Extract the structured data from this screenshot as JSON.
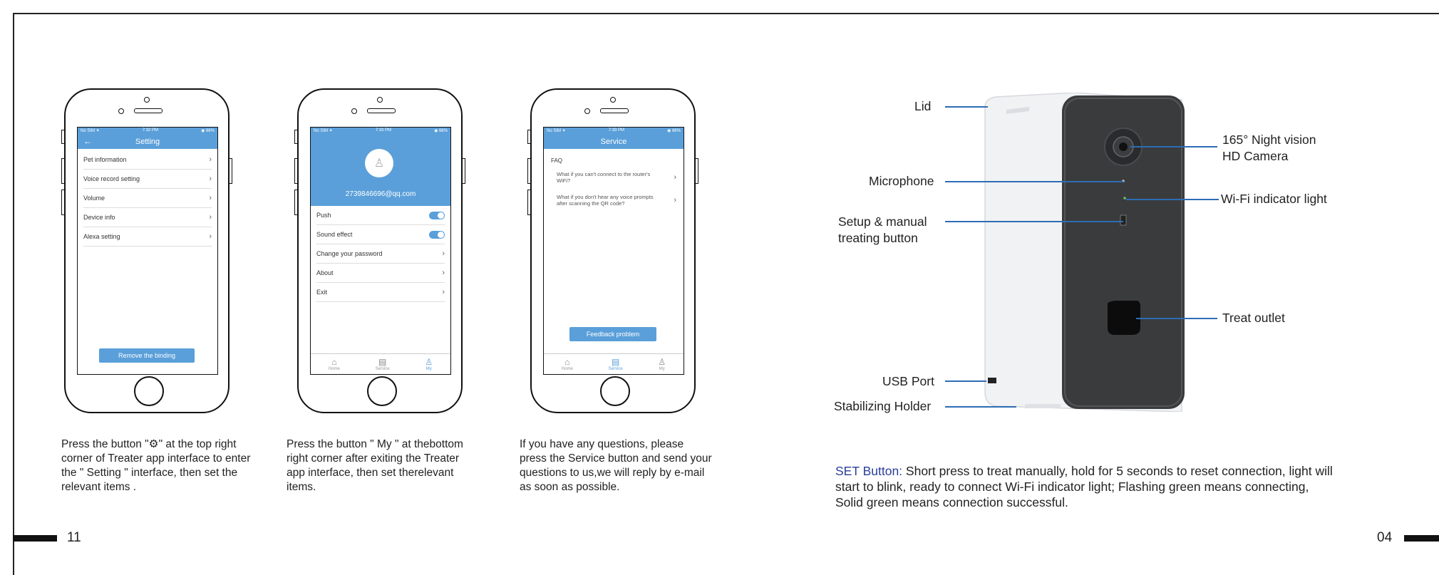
{
  "phones": [
    {
      "status_left": "No SIM ✦",
      "status_time": "7:32 PM",
      "status_right": "◉ 66%",
      "title": "Setting",
      "rows": [
        "Pet information",
        "Voice record setting",
        "Volume",
        "Device info",
        "Alexa setting"
      ],
      "button": "Remove the binding"
    },
    {
      "status_left": "No SIM ✦",
      "status_time": "7:33 PM",
      "status_right": "◉ 66%",
      "email": "2739846696@qq.com",
      "toggle_rows": [
        "Push",
        "Sound effect"
      ],
      "rows": [
        "Change your password",
        "About",
        "Exit"
      ],
      "tabs": [
        "Home",
        "Service",
        "My"
      ],
      "active_tab": "My"
    },
    {
      "status_left": "No SIM ✦",
      "status_time": "7:33 PM",
      "status_right": "◉ 66%",
      "title": "Service",
      "faq_heading": "FAQ",
      "faqs": [
        "What if you can't connect to the router's WiFi?",
        "What if you don't hear any voice prompts after scanning the QR code?"
      ],
      "button": "Feedback problem",
      "tabs": [
        "Home",
        "Service",
        "My"
      ],
      "active_tab": "Service"
    }
  ],
  "captions": [
    "Press the button \"⚙\" at the top right corner of Treater app interface to enter the \" Setting \" interface, then set the relevant items .",
    "Press the button \" My \" at thebottom right corner after exiting the Treater app interface,  then set therelevant items.",
    "If you have any questions, please press the Service button and send your questions to us,we will reply by e-mail as soon as possible."
  ],
  "device_labels": {
    "lid": "Lid",
    "microphone": "Microphone",
    "setup_button_line1": "Setup & manual",
    "setup_button_line2": "treating button",
    "usb": "USB Port",
    "holder": "Stabilizing Holder",
    "camera_line1": "165° Night vision",
    "camera_line2": "HD Camera",
    "wifi": "Wi-Fi indicator light",
    "outlet": "Treat outlet"
  },
  "set_info": {
    "heading": "SET Button:",
    "text": " Short press to treat manually, hold for 5 seconds to reset connection, light will start to blink, ready to connect Wi-Fi indicator light; Flashing green means connecting, Solid green means connection successful."
  },
  "page_left": "11",
  "page_right": "04",
  "colors": {
    "app_blue": "#5a9fd9",
    "leader_blue": "#2d6db5",
    "device_face": "#3a3b3d"
  }
}
